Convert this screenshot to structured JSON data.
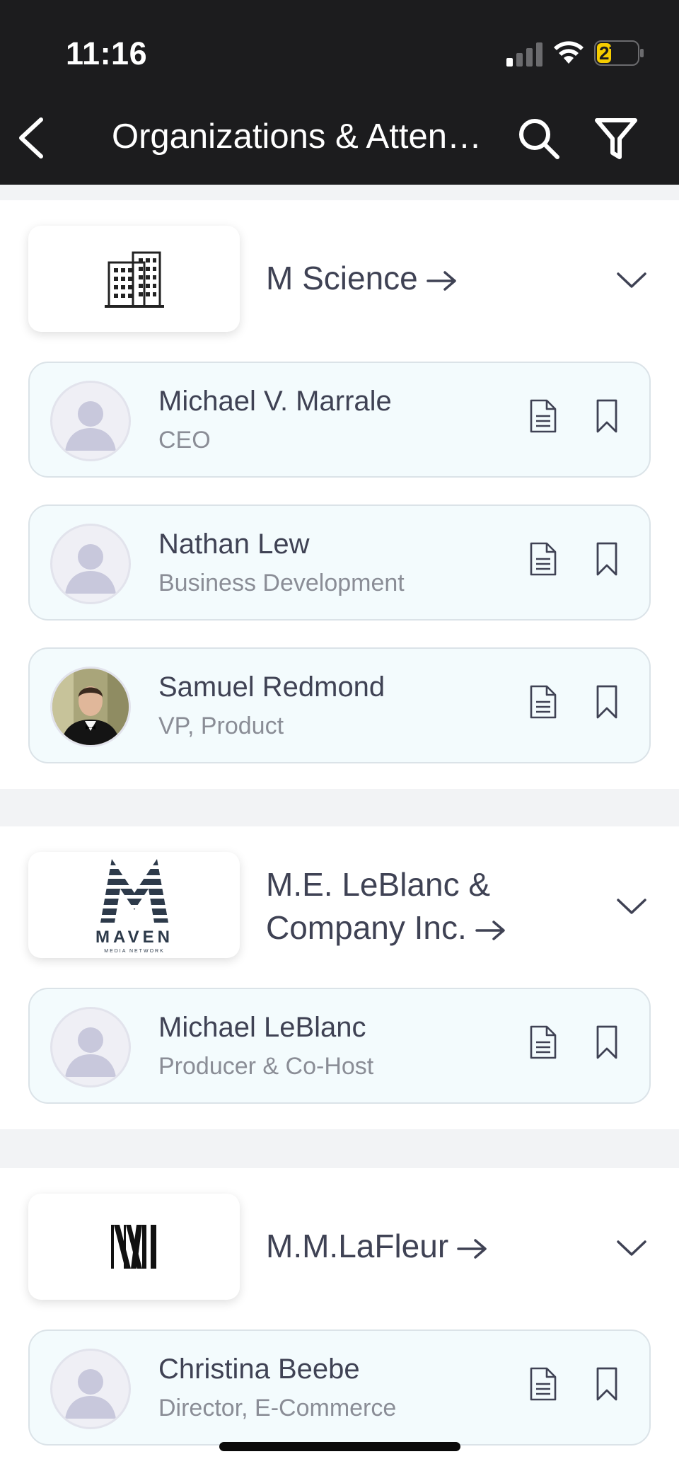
{
  "status_bar": {
    "time": "11:16",
    "battery": "27"
  },
  "header": {
    "title": "Organizations & Atten…",
    "icons": [
      "back-icon",
      "search-icon",
      "filter-icon"
    ]
  },
  "colors": {
    "header_bg": "#1c1c1e",
    "card_bg": "#f3fbfd",
    "battery_fill": "#f5cc00",
    "text_primary": "#3f4254",
    "text_secondary": "#8a8d96"
  },
  "organizations": [
    {
      "name": "M Science",
      "logo": "building-icon",
      "people": [
        {
          "name": "Michael V. Marrale",
          "title": "CEO",
          "avatar": "placeholder"
        },
        {
          "name": "Nathan Lew",
          "title": "Business Development",
          "avatar": "placeholder"
        },
        {
          "name": "Samuel Redmond",
          "title": "VP, Product",
          "avatar": "photo"
        }
      ]
    },
    {
      "name": "M.E. LeBlanc & Company Inc.",
      "logo": "maven-logo",
      "logo_text": "MAVEN",
      "logo_subtext": "MEDIA NETWORK",
      "people": [
        {
          "name": "Michael LeBlanc",
          "title": "Producer & Co-Host",
          "avatar": "placeholder"
        }
      ]
    },
    {
      "name": "M.M.LaFleur",
      "logo": "mm-logo",
      "people": [
        {
          "name": "Christina Beebe",
          "title": "Director, E-Commerce",
          "avatar": "placeholder"
        }
      ]
    }
  ]
}
